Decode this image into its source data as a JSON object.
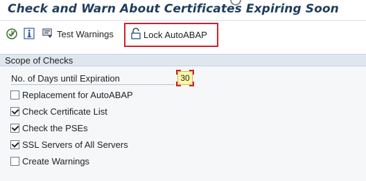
{
  "page": {
    "title": "Check and Warn About Certificates Expiring Soon"
  },
  "toolbar": {
    "execute_icon": "execute-clock-icon",
    "info_icon": "info-icon",
    "test_warnings_label": "Test Warnings",
    "test_warnings_icon": "test-warnings-icon",
    "lock_label": "Lock AutoABAP",
    "lock_icon": "lock-icon"
  },
  "scope": {
    "header": "Scope of Checks",
    "days_label": "No. of Days until Expiration",
    "days_value": "30",
    "checkboxes": [
      {
        "label": "Replacement for AutoABAP",
        "checked": false
      },
      {
        "label": "Check Certificate List",
        "checked": true
      },
      {
        "label": "Check the PSEs",
        "checked": true
      },
      {
        "label": "SSL Servers of All Servers",
        "checked": true
      },
      {
        "label": "Create Warnings",
        "checked": false
      }
    ]
  },
  "colors": {
    "title": "#1f3c5e",
    "highlight_red": "#d21f2a",
    "group_header_bg": "#dfe6ee",
    "input_bg": "#fff7a6"
  }
}
